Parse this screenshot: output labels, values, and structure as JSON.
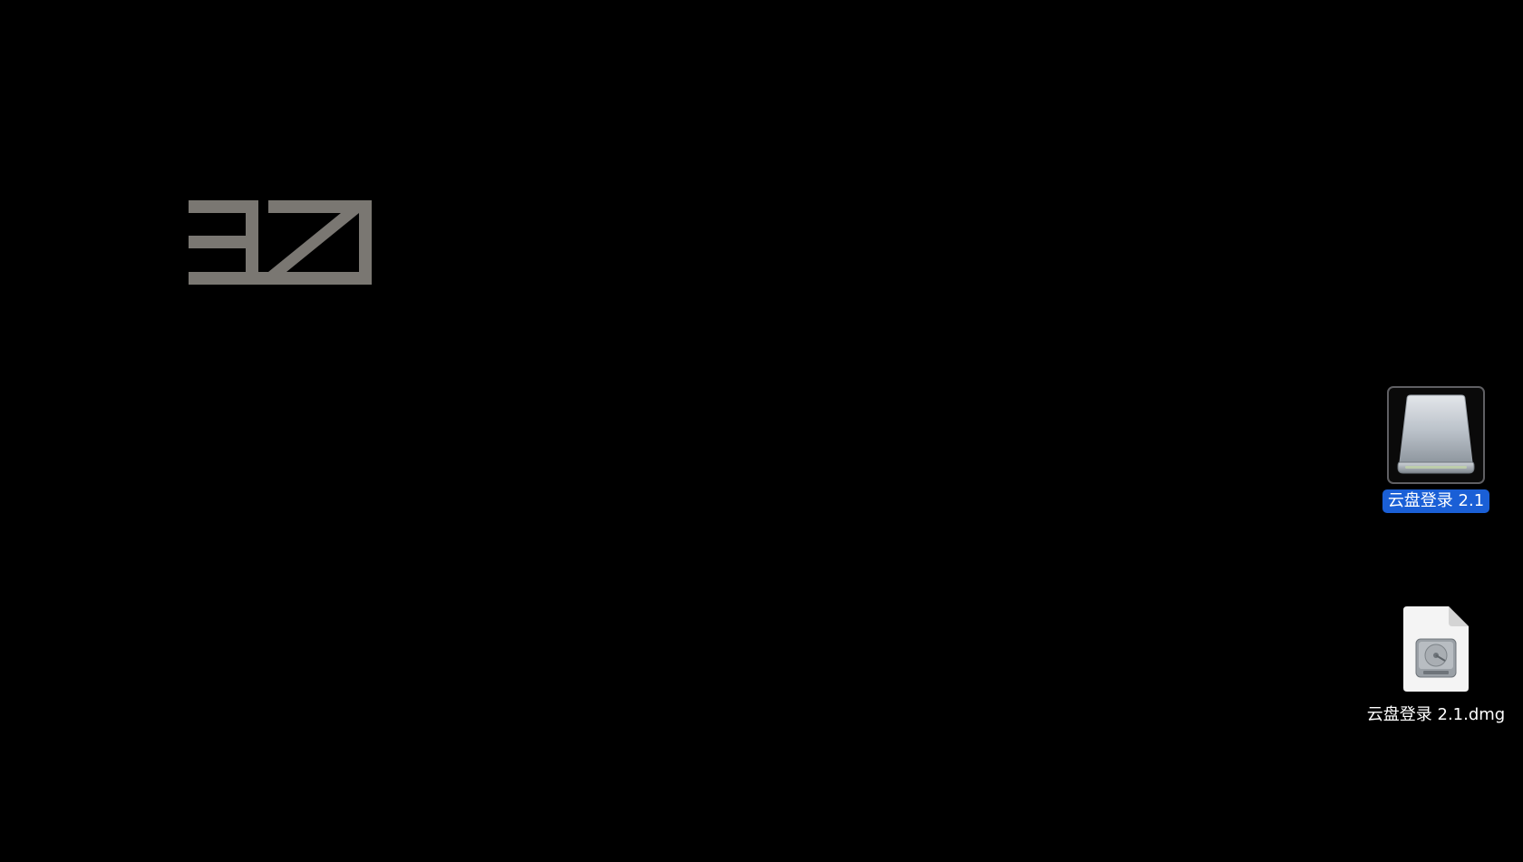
{
  "desktop": {
    "background_color": "#000000",
    "wallpaper_logo": {
      "icon": "abstract-geometric-logo",
      "color": "#7a7772"
    },
    "icons": [
      {
        "label": "云盘登录 2.1",
        "icon": "external-drive-icon",
        "selected": true
      },
      {
        "label": "云盘登录 2.1.dmg",
        "icon": "disk-image-file-icon",
        "selected": false
      }
    ],
    "selection_color": "#1a5fd6"
  }
}
